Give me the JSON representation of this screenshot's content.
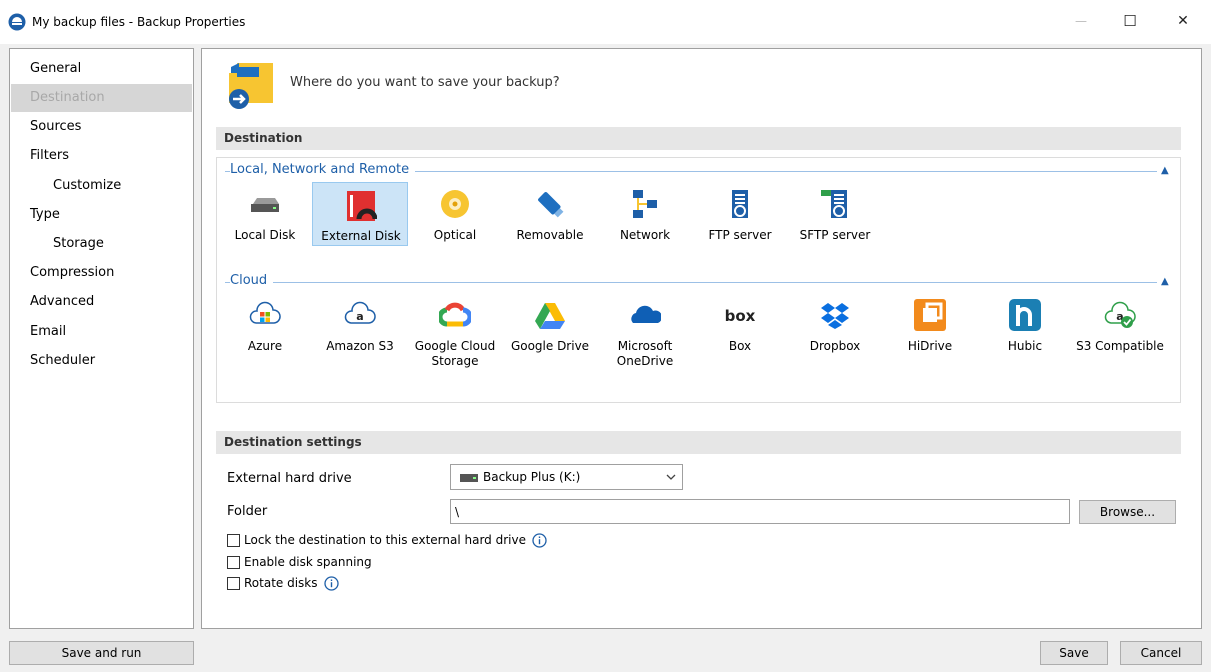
{
  "window": {
    "title": "My backup files - Backup Properties",
    "minimize_glyph": "—",
    "maximize_glyph": "☐",
    "close_glyph": "✕"
  },
  "sidebar": {
    "items": [
      {
        "label": "General",
        "sub": false,
        "active": false
      },
      {
        "label": "Destination",
        "sub": false,
        "active": true
      },
      {
        "label": "Sources",
        "sub": false,
        "active": false
      },
      {
        "label": "Filters",
        "sub": false,
        "active": false
      },
      {
        "label": "Customize",
        "sub": true,
        "active": false
      },
      {
        "label": "Type",
        "sub": false,
        "active": false
      },
      {
        "label": "Storage",
        "sub": true,
        "active": false
      },
      {
        "label": "Compression",
        "sub": false,
        "active": false
      },
      {
        "label": "Advanced",
        "sub": false,
        "active": false
      },
      {
        "label": "Email",
        "sub": false,
        "active": false
      },
      {
        "label": "Scheduler",
        "sub": false,
        "active": false
      }
    ]
  },
  "main": {
    "header_question": "Where do you want to save your backup?",
    "destination_section": "Destination",
    "local_group": "Local, Network and Remote",
    "local_items": [
      {
        "label": "Local Disk",
        "icon": "local-disk-icon",
        "selected": false
      },
      {
        "label": "External Disk",
        "icon": "external-disk-icon",
        "selected": true
      },
      {
        "label": "Optical",
        "icon": "optical-disc-icon",
        "selected": false
      },
      {
        "label": "Removable",
        "icon": "usb-drive-icon",
        "selected": false
      },
      {
        "label": "Network",
        "icon": "network-icon",
        "selected": false
      },
      {
        "label": "FTP server",
        "icon": "ftp-server-icon",
        "selected": false
      },
      {
        "label": "SFTP server",
        "icon": "sftp-server-icon",
        "selected": false
      }
    ],
    "cloud_group": "Cloud",
    "cloud_items": [
      {
        "label": "Azure",
        "icon": "azure-icon"
      },
      {
        "label": "Amazon S3",
        "icon": "amazon-s3-icon"
      },
      {
        "label": "Google Cloud Storage",
        "icon": "google-cloud-icon"
      },
      {
        "label": "Google Drive",
        "icon": "google-drive-icon"
      },
      {
        "label": "Microsoft OneDrive",
        "icon": "onedrive-icon"
      },
      {
        "label": "Box",
        "icon": "box-icon"
      },
      {
        "label": "Dropbox",
        "icon": "dropbox-icon"
      },
      {
        "label": "HiDrive",
        "icon": "hidrive-icon"
      },
      {
        "label": "Hubic",
        "icon": "hubic-icon"
      },
      {
        "label": "S3 Compatible",
        "icon": "s3-compatible-icon"
      }
    ],
    "settings_section": "Destination settings",
    "external_drive_label": "External hard drive",
    "external_drive_value": "Backup Plus (K:)",
    "folder_label": "Folder",
    "folder_value": "\\",
    "browse_label": "Browse...",
    "lock_label": "Lock the destination to this external hard drive",
    "spanning_label": "Enable disk spanning",
    "rotate_label": "Rotate disks",
    "box_logo_text": "box"
  },
  "footer": {
    "save_run_label": "Save and run",
    "save_label": "Save",
    "cancel_label": "Cancel"
  },
  "colors": {
    "accent": "#1e5fa8",
    "selected_bg": "#cce4f7",
    "section_bg": "#e6e6e6"
  }
}
